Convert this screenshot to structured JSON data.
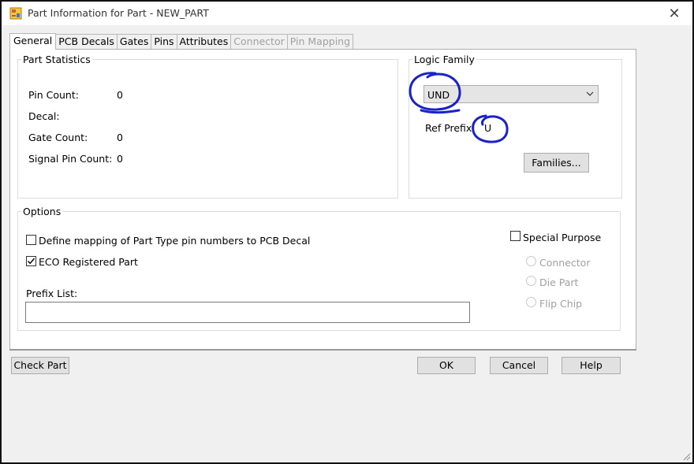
{
  "window": {
    "title": "Part Information for Part - NEW_PART",
    "close_glyph": "✕"
  },
  "tabs": [
    {
      "label": "General",
      "active": true,
      "enabled": true
    },
    {
      "label": "PCB Decals",
      "active": false,
      "enabled": true
    },
    {
      "label": "Gates",
      "active": false,
      "enabled": true
    },
    {
      "label": "Pins",
      "active": false,
      "enabled": true
    },
    {
      "label": "Attributes",
      "active": false,
      "enabled": true
    },
    {
      "label": "Connector",
      "active": false,
      "enabled": false
    },
    {
      "label": "Pin Mapping",
      "active": false,
      "enabled": false
    }
  ],
  "part_statistics": {
    "legend": "Part Statistics",
    "pin_count_label": "Pin Count:",
    "pin_count_value": "0",
    "decal_label": "Decal:",
    "decal_value": "",
    "gate_count_label": "Gate Count:",
    "gate_count_value": "0",
    "signal_pin_count_label": "Signal Pin Count:",
    "signal_pin_count_value": "0"
  },
  "logic_family": {
    "legend": "Logic Family",
    "selected": "UND",
    "ref_prefix_label": "Ref Prefix:",
    "ref_prefix_value": "U",
    "families_button": "Families..."
  },
  "options": {
    "legend": "Options",
    "define_mapping_label": "Define mapping of Part Type pin numbers to PCB Decal",
    "define_mapping_checked": false,
    "eco_registered_label": "ECO Registered Part",
    "eco_registered_checked": true,
    "prefix_list_label": "Prefix List:",
    "prefix_list_value": "",
    "special_purpose_label": "Special Purpose",
    "special_purpose_checked": false,
    "special_options": [
      "Connector",
      "Die Part",
      "Flip Chip"
    ]
  },
  "buttons": {
    "check_part": "Check Part",
    "ok": "OK",
    "cancel": "Cancel",
    "help": "Help"
  },
  "colors": {
    "annotation_ink": "#1a23c8",
    "panel_bg": "#ffffff",
    "window_bg": "#f0f0f0"
  },
  "icons": {
    "app": "app-icon",
    "close": "close-icon",
    "dropdown": "chevron-down-icon",
    "checkmark": "checkmark-icon"
  }
}
